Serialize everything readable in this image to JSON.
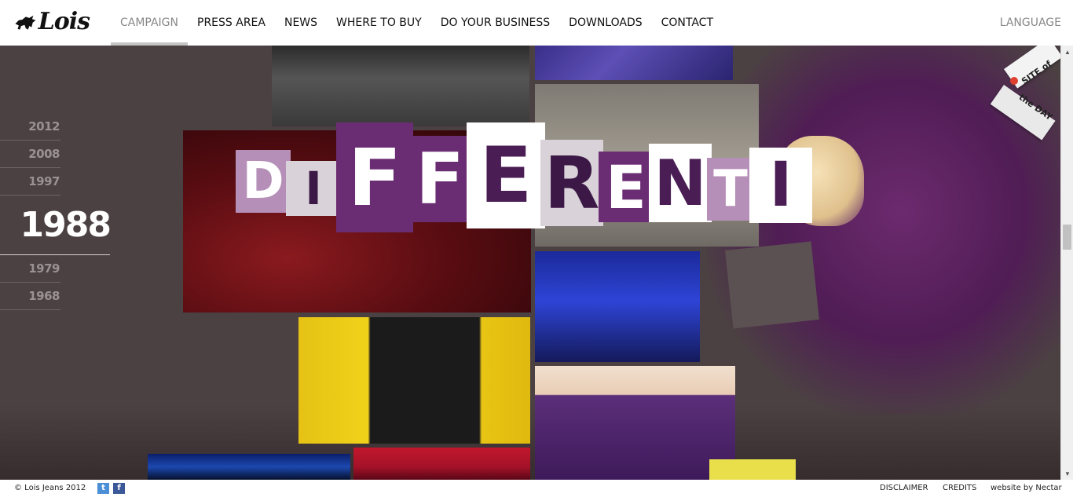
{
  "header": {
    "logo_text": "Lois",
    "nav": [
      "CAMPAIGN",
      "PRESS AREA",
      "NEWS",
      "WHERE TO BUY",
      "DO YOUR BUSINESS",
      "DOWNLOADS",
      "CONTACT"
    ],
    "active_nav": "CAMPAIGN",
    "language": "LANGUAGE"
  },
  "years": {
    "items": [
      "2012",
      "2008",
      "1997",
      "1988",
      "1979",
      "1968"
    ],
    "active": "1988"
  },
  "hero": {
    "word_letters": [
      "D",
      "I",
      "F",
      "F",
      "E",
      "R",
      "E",
      "N",
      "T",
      "I"
    ]
  },
  "badge": {
    "line1": "SITE of",
    "line2": "the DAY"
  },
  "footer": {
    "copyright": "© Lois Jeans 2012",
    "twitter": "t",
    "facebook": "f",
    "disclaimer": "DISCLAIMER",
    "credits": "CREDITS",
    "byline": "website by Nectar"
  },
  "colors": {
    "accent_purple": "#6a2c72",
    "background": "#4b4142"
  }
}
